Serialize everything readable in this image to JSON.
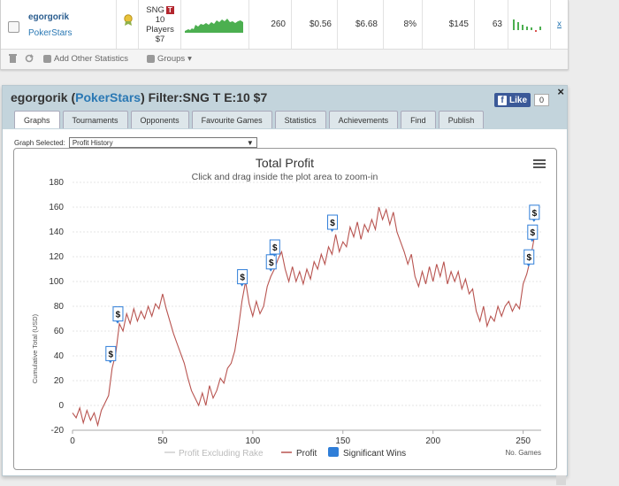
{
  "table_row": {
    "player_name": "egorgorik",
    "site": "PokerStars",
    "game_line1": "SNG",
    "game_badge": "T",
    "game_line2": "10",
    "game_line3": "Players",
    "game_line4": "$7",
    "games": "260",
    "avg_profit": "$0.56",
    "avg_stake": "$6.68",
    "roi": "8%",
    "total_profit": "$145",
    "ability": "63",
    "remove_label": "x"
  },
  "toolbar": {
    "add_stats_label": "Add Other Statistics",
    "groups_label": "Groups"
  },
  "panel": {
    "player_name": "egorgorik",
    "site_open": "(",
    "site": "PokerStars",
    "site_close": ")",
    "filter_label": " Filter:SNG T E:10 $7",
    "like_label": "Like",
    "like_count": "0",
    "close_label": "×"
  },
  "tabs": [
    {
      "label": "Graphs",
      "active": true
    },
    {
      "label": "Tournaments"
    },
    {
      "label": "Opponents"
    },
    {
      "label": "Favourite Games"
    },
    {
      "label": "Statistics"
    },
    {
      "label": "Achievements"
    },
    {
      "label": "Find"
    },
    {
      "label": "Publish"
    }
  ],
  "graph_select": {
    "label": "Graph Selected:",
    "value": "Profit History"
  },
  "chart_data": {
    "type": "line",
    "title": "Total Profit",
    "subtitle": "Click and drag inside the plot area to zoom-in",
    "ylabel": "Cumulative Total (USD)",
    "xlabel": "No. Games",
    "xlim": [
      0,
      260
    ],
    "ylim": [
      -20,
      180
    ],
    "x_ticks": [
      0,
      50,
      100,
      150,
      200,
      250
    ],
    "y_ticks": [
      -20,
      0,
      20,
      40,
      60,
      80,
      100,
      120,
      140,
      160,
      180
    ],
    "grid": true,
    "legend_position": "bottom",
    "legend": [
      "Profit Excluding Rake",
      "Profit",
      "Significant Wins"
    ],
    "series": [
      {
        "name": "Profit",
        "color": "#b85450",
        "points": [
          [
            0,
            -6
          ],
          [
            2,
            -10
          ],
          [
            4,
            -2
          ],
          [
            6,
            -14
          ],
          [
            8,
            -4
          ],
          [
            10,
            -12
          ],
          [
            12,
            -6
          ],
          [
            14,
            -16
          ],
          [
            16,
            -4
          ],
          [
            18,
            2
          ],
          [
            20,
            8
          ],
          [
            22,
            30
          ],
          [
            24,
            42
          ],
          [
            26,
            66
          ],
          [
            28,
            60
          ],
          [
            30,
            74
          ],
          [
            32,
            66
          ],
          [
            34,
            78
          ],
          [
            36,
            68
          ],
          [
            38,
            76
          ],
          [
            40,
            70
          ],
          [
            42,
            80
          ],
          [
            44,
            72
          ],
          [
            46,
            82
          ],
          [
            48,
            78
          ],
          [
            50,
            90
          ],
          [
            52,
            78
          ],
          [
            54,
            68
          ],
          [
            56,
            58
          ],
          [
            58,
            50
          ],
          [
            60,
            42
          ],
          [
            62,
            34
          ],
          [
            64,
            22
          ],
          [
            66,
            12
          ],
          [
            68,
            6
          ],
          [
            70,
            0
          ],
          [
            72,
            10
          ],
          [
            74,
            0
          ],
          [
            76,
            16
          ],
          [
            78,
            6
          ],
          [
            80,
            12
          ],
          [
            82,
            22
          ],
          [
            84,
            18
          ],
          [
            86,
            30
          ],
          [
            88,
            34
          ],
          [
            90,
            44
          ],
          [
            92,
            62
          ],
          [
            94,
            84
          ],
          [
            96,
            100
          ],
          [
            98,
            82
          ],
          [
            100,
            72
          ],
          [
            102,
            84
          ],
          [
            104,
            74
          ],
          [
            106,
            80
          ],
          [
            108,
            96
          ],
          [
            110,
            104
          ],
          [
            112,
            110
          ],
          [
            114,
            118
          ],
          [
            116,
            124
          ],
          [
            118,
            110
          ],
          [
            120,
            100
          ],
          [
            122,
            112
          ],
          [
            124,
            100
          ],
          [
            126,
            108
          ],
          [
            128,
            98
          ],
          [
            130,
            110
          ],
          [
            132,
            102
          ],
          [
            134,
            116
          ],
          [
            136,
            110
          ],
          [
            138,
            122
          ],
          [
            140,
            114
          ],
          [
            142,
            128
          ],
          [
            144,
            122
          ],
          [
            146,
            138
          ],
          [
            148,
            124
          ],
          [
            150,
            132
          ],
          [
            152,
            128
          ],
          [
            154,
            144
          ],
          [
            156,
            136
          ],
          [
            158,
            148
          ],
          [
            160,
            134
          ],
          [
            162,
            146
          ],
          [
            164,
            140
          ],
          [
            166,
            150
          ],
          [
            168,
            142
          ],
          [
            170,
            160
          ],
          [
            172,
            150
          ],
          [
            174,
            158
          ],
          [
            176,
            146
          ],
          [
            178,
            156
          ],
          [
            180,
            140
          ],
          [
            182,
            132
          ],
          [
            184,
            124
          ],
          [
            186,
            114
          ],
          [
            188,
            122
          ],
          [
            190,
            104
          ],
          [
            192,
            96
          ],
          [
            194,
            108
          ],
          [
            196,
            98
          ],
          [
            198,
            112
          ],
          [
            200,
            100
          ],
          [
            202,
            114
          ],
          [
            204,
            104
          ],
          [
            206,
            116
          ],
          [
            208,
            98
          ],
          [
            210,
            108
          ],
          [
            212,
            100
          ],
          [
            214,
            108
          ],
          [
            216,
            94
          ],
          [
            218,
            102
          ],
          [
            220,
            90
          ],
          [
            222,
            94
          ],
          [
            224,
            76
          ],
          [
            226,
            68
          ],
          [
            228,
            80
          ],
          [
            230,
            64
          ],
          [
            232,
            72
          ],
          [
            234,
            68
          ],
          [
            236,
            80
          ],
          [
            238,
            72
          ],
          [
            240,
            80
          ],
          [
            242,
            84
          ],
          [
            244,
            76
          ],
          [
            246,
            82
          ],
          [
            248,
            78
          ],
          [
            250,
            98
          ],
          [
            252,
            106
          ],
          [
            254,
            118
          ],
          [
            256,
            134
          ],
          [
            258,
            142
          ]
        ]
      }
    ],
    "significant_wins": [
      [
        21,
        34
      ],
      [
        25,
        66
      ],
      [
        94,
        96
      ],
      [
        110,
        108
      ],
      [
        112,
        120
      ],
      [
        144,
        140
      ],
      [
        253,
        112
      ],
      [
        255,
        132
      ],
      [
        256,
        148
      ]
    ],
    "significant_win_label": "$"
  },
  "colors": {
    "header_bg": "#c3d4dc",
    "link": "#2a78b4",
    "line": "#b85450",
    "badge": "#b3262e",
    "wins_legend": "#2f7ed8"
  }
}
